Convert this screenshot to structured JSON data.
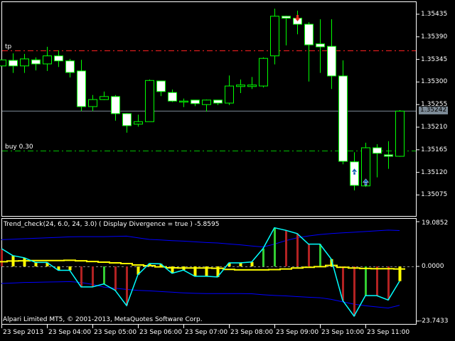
{
  "colors": {
    "bull_outline": "#00ff00",
    "bear_fill": "#ffffff",
    "tp_line": "#ff2020",
    "buy_line": "#00c000",
    "bid_line": "#7c8a96",
    "hist_up": "#32cd32",
    "hist_down": "#b22222",
    "hist_flat": "#ffff00",
    "main_line": "#00ffff",
    "signal_line": "#ffff00",
    "bands": "#0000ff"
  },
  "main_chart": {
    "price_axis": [
      "1.35435",
      "1.35390",
      "1.35345",
      "1.35300",
      "1.35255",
      "1.35210",
      "1.35165",
      "1.35120",
      "1.35075"
    ],
    "price_axis_values": [
      1.35435,
      1.3539,
      1.35345,
      1.353,
      1.35255,
      1.3521,
      1.35165,
      1.3512,
      1.35075
    ],
    "current_price_label": "1.35242",
    "current_price": 1.35242,
    "tp_label": "tp",
    "tp_price": 1.35363,
    "buy_label": "buy 0.30",
    "buy_price": 1.35163,
    "candles": [
      {
        "t": "03:00",
        "o": 1.35332,
        "h": 1.35344,
        "l": 1.35332,
        "c": 1.35344
      },
      {
        "t": "03:15",
        "o": 1.35343,
        "h": 1.35357,
        "l": 1.35318,
        "c": 1.35332
      },
      {
        "t": "03:30",
        "o": 1.35332,
        "h": 1.35356,
        "l": 1.35318,
        "c": 1.35346
      },
      {
        "t": "03:45",
        "o": 1.35344,
        "h": 1.35349,
        "l": 1.35323,
        "c": 1.35336
      },
      {
        "t": "04:00",
        "o": 1.35336,
        "h": 1.3537,
        "l": 1.35322,
        "c": 1.35352
      },
      {
        "t": "04:15",
        "o": 1.35352,
        "h": 1.35363,
        "l": 1.3533,
        "c": 1.35342
      },
      {
        "t": "04:30",
        "o": 1.35342,
        "h": 1.35346,
        "l": 1.35309,
        "c": 1.35319
      },
      {
        "t": "04:45",
        "o": 1.35322,
        "h": 1.35344,
        "l": 1.35242,
        "c": 1.35251
      },
      {
        "t": "05:00",
        "o": 1.35251,
        "h": 1.35274,
        "l": 1.35242,
        "c": 1.35265
      },
      {
        "t": "05:15",
        "o": 1.35265,
        "h": 1.35281,
        "l": 1.35264,
        "c": 1.35271
      },
      {
        "t": "05:30",
        "o": 1.35271,
        "h": 1.35274,
        "l": 1.35223,
        "c": 1.35237
      },
      {
        "t": "05:45",
        "o": 1.35237,
        "h": 1.35238,
        "l": 1.35199,
        "c": 1.35213
      },
      {
        "t": "06:00",
        "o": 1.35216,
        "h": 1.35235,
        "l": 1.35211,
        "c": 1.35221
      },
      {
        "t": "06:15",
        "o": 1.35221,
        "h": 1.35305,
        "l": 1.35221,
        "c": 1.35303
      },
      {
        "t": "06:30",
        "o": 1.35302,
        "h": 1.35302,
        "l": 1.35272,
        "c": 1.35281
      },
      {
        "t": "06:45",
        "o": 1.35279,
        "h": 1.35285,
        "l": 1.3526,
        "c": 1.35262
      },
      {
        "t": "07:00",
        "o": 1.35262,
        "h": 1.35267,
        "l": 1.3525,
        "c": 1.35262
      },
      {
        "t": "07:15",
        "o": 1.35264,
        "h": 1.35264,
        "l": 1.35252,
        "c": 1.35257
      },
      {
        "t": "07:30",
        "o": 1.35255,
        "h": 1.35265,
        "l": 1.35241,
        "c": 1.35264
      },
      {
        "t": "07:45",
        "o": 1.35264,
        "h": 1.35264,
        "l": 1.35254,
        "c": 1.35258
      },
      {
        "t": "08:00",
        "o": 1.35258,
        "h": 1.35313,
        "l": 1.35254,
        "c": 1.35292
      },
      {
        "t": "08:15",
        "o": 1.35291,
        "h": 1.35305,
        "l": 1.35278,
        "c": 1.35294
      },
      {
        "t": "08:30",
        "o": 1.35291,
        "h": 1.3531,
        "l": 1.35286,
        "c": 1.35294
      },
      {
        "t": "08:45",
        "o": 1.35292,
        "h": 1.35349,
        "l": 1.35289,
        "c": 1.35347
      },
      {
        "t": "09:00",
        "o": 1.35352,
        "h": 1.35446,
        "l": 1.35335,
        "c": 1.35431
      },
      {
        "t": "09:15",
        "o": 1.35431,
        "h": 1.35432,
        "l": 1.35373,
        "c": 1.35427
      },
      {
        "t": "09:30",
        "o": 1.35427,
        "h": 1.35442,
        "l": 1.35395,
        "c": 1.35415
      },
      {
        "t": "09:45",
        "o": 1.35415,
        "h": 1.35419,
        "l": 1.35301,
        "c": 1.35374
      },
      {
        "t": "10:00",
        "o": 1.35376,
        "h": 1.35425,
        "l": 1.35318,
        "c": 1.3537
      },
      {
        "t": "10:15",
        "o": 1.35371,
        "h": 1.35425,
        "l": 1.35286,
        "c": 1.35312
      },
      {
        "t": "10:30",
        "o": 1.35312,
        "h": 1.35343,
        "l": 1.35136,
        "c": 1.35142
      },
      {
        "t": "10:45",
        "o": 1.35141,
        "h": 1.3516,
        "l": 1.35084,
        "c": 1.35094
      },
      {
        "t": "11:00",
        "o": 1.35093,
        "h": 1.35179,
        "l": 1.35091,
        "c": 1.35169
      },
      {
        "t": "11:15",
        "o": 1.35169,
        "h": 1.35176,
        "l": 1.3511,
        "c": 1.35158
      },
      {
        "t": "11:30",
        "o": 1.35155,
        "h": 1.35182,
        "l": 1.35127,
        "c": 1.35152
      },
      {
        "t": "11:45",
        "o": 1.35152,
        "h": 1.35244,
        "l": 1.35151,
        "c": 1.35242
      }
    ],
    "markers": [
      {
        "candle": 26,
        "type": "sell-arrow",
        "color": "#e03020"
      },
      {
        "candle": 31,
        "type": "buy-arrow",
        "color": "#1060b0"
      },
      {
        "candle": 32,
        "type": "buy-arrow",
        "color": "#1060b0"
      }
    ]
  },
  "indicator": {
    "title": "Trend_check(24, 6.0, 24, 3.0) ( Display Divergence = true ) -5.8595",
    "axis_max_label": "19.0852",
    "axis_zero_label": "0.0000",
    "axis_min_label": "-23.7433",
    "ylim": [
      -23.7433,
      19.0852
    ],
    "main": [
      7.6,
      4.6,
      3.7,
      1.7,
      1.7,
      -1.7,
      -1.7,
      -8.9,
      -8.9,
      -7.6,
      -10.4,
      -17.0,
      -3.6,
      1.2,
      1.1,
      -3.0,
      -1.6,
      -4.3,
      -4.3,
      -4.6,
      1.5,
      1.5,
      1.9,
      7.6,
      16.5,
      15.4,
      14.0,
      9.5,
      9.5,
      3.1,
      -14.8,
      -21.6,
      -12.7,
      -12.7,
      -14.6,
      -6.4
    ],
    "hist_colors": [
      "down",
      "flat",
      "flat",
      "flat",
      "flat",
      "flat",
      "flat",
      "down",
      "down",
      "up",
      "down",
      "down",
      "flat",
      "flat",
      "flat",
      "flat",
      "flat",
      "flat",
      "flat",
      "flat",
      "flat",
      "flat",
      "flat",
      "up",
      "up",
      "down",
      "down",
      "down",
      "up",
      "flat",
      "down",
      "down",
      "up",
      "down",
      "down",
      "flat"
    ],
    "signal": [
      2.0,
      2.3,
      2.4,
      2.5,
      2.5,
      2.5,
      2.6,
      2.4,
      2.1,
      1.8,
      1.5,
      1.2,
      0.6,
      0.3,
      -0.2,
      -0.6,
      -0.7,
      -0.7,
      -0.7,
      -0.8,
      -1.3,
      -1.5,
      -1.5,
      -1.5,
      -1.4,
      -1.1,
      -0.7,
      -0.4,
      -0.1,
      0.4,
      -0.4,
      -0.7,
      -0.9,
      -1.0,
      -1.0,
      -1.1
    ],
    "upper_band": [
      11.4,
      11.6,
      11.8,
      12.0,
      12.2,
      12.4,
      12.6,
      12.7,
      12.7,
      12.7,
      12.8,
      12.9,
      12.2,
      11.5,
      11.3,
      11.0,
      10.8,
      10.5,
      10.2,
      10.0,
      9.6,
      9.2,
      8.7,
      8.3,
      9.5,
      11.0,
      12.2,
      13.0,
      13.6,
      14.0,
      14.3,
      14.6,
      14.9,
      15.2,
      15.5,
      15.3
    ],
    "lower_band": [
      -7.4,
      -7.2,
      -7.0,
      -6.9,
      -6.8,
      -6.7,
      -6.6,
      -7.0,
      -7.8,
      -9.0,
      -9.5,
      -10.0,
      -10.4,
      -10.6,
      -10.9,
      -11.2,
      -11.5,
      -11.7,
      -11.8,
      -11.8,
      -11.8,
      -11.8,
      -11.9,
      -12.3,
      -12.6,
      -12.8,
      -13.1,
      -13.4,
      -13.6,
      -14.3,
      -15.4,
      -16.4,
      -17.1,
      -17.6,
      -18.1,
      -16.9
    ]
  },
  "copyright": "Alpari Limited MT5, © 2001-2013, MetaQuotes Software Corp.",
  "time_axis": [
    {
      "label": "23 Sep 2013",
      "candle": 0
    },
    {
      "label": "23 Sep 04:00",
      "candle": 4
    },
    {
      "label": "23 Sep 05:00",
      "candle": 8
    },
    {
      "label": "23 Sep 06:00",
      "candle": 12
    },
    {
      "label": "23 Sep 07:00",
      "candle": 16
    },
    {
      "label": "23 Sep 08:00",
      "candle": 20
    },
    {
      "label": "23 Sep 09:00",
      "candle": 24
    },
    {
      "label": "23 Sep 10:00",
      "candle": 28
    },
    {
      "label": "23 Sep 11:00",
      "candle": 32
    }
  ]
}
